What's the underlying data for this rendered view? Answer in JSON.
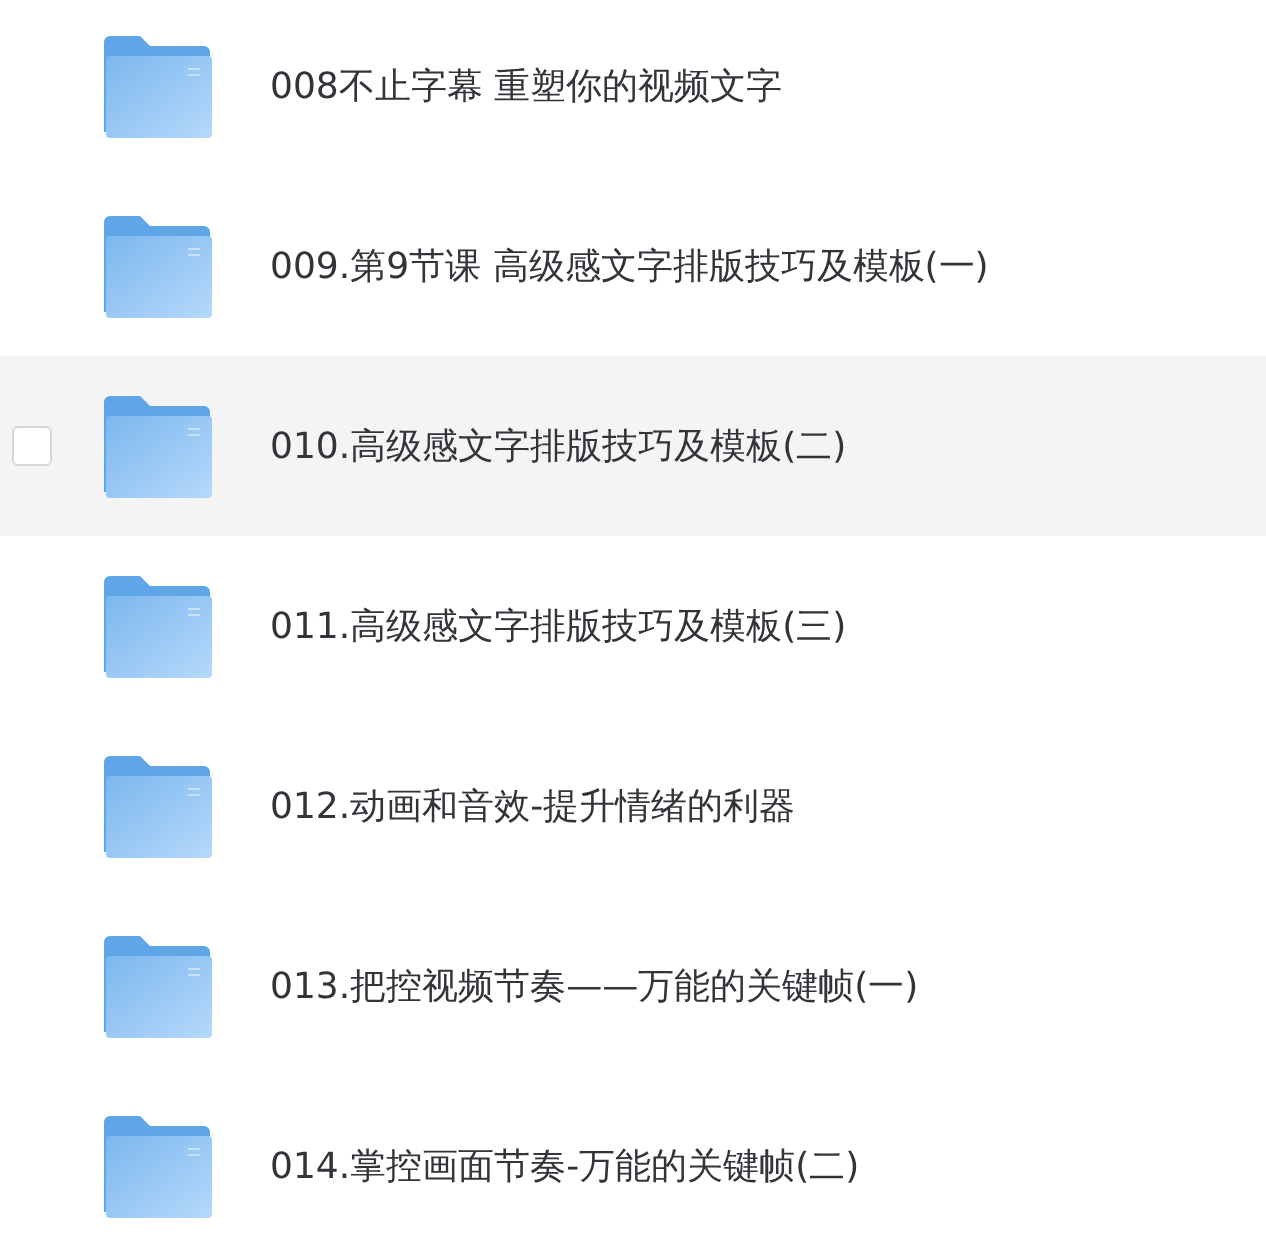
{
  "folders": [
    {
      "name": "008不止字幕 重塑你的视频文字",
      "hovered": false
    },
    {
      "name": "009.第9节课 高级感文字排版技巧及模板(一)",
      "hovered": false
    },
    {
      "name": "010.高级感文字排版技巧及模板(二)",
      "hovered": true
    },
    {
      "name": "011.高级感文字排版技巧及模板(三)",
      "hovered": false
    },
    {
      "name": "012.动画和音效-提升情绪的利器",
      "hovered": false
    },
    {
      "name": "013.把控视频节奏——万能的关键帧(一)",
      "hovered": false
    },
    {
      "name": "014.掌控画面节奏-万能的关键帧(二)",
      "hovered": false
    }
  ]
}
